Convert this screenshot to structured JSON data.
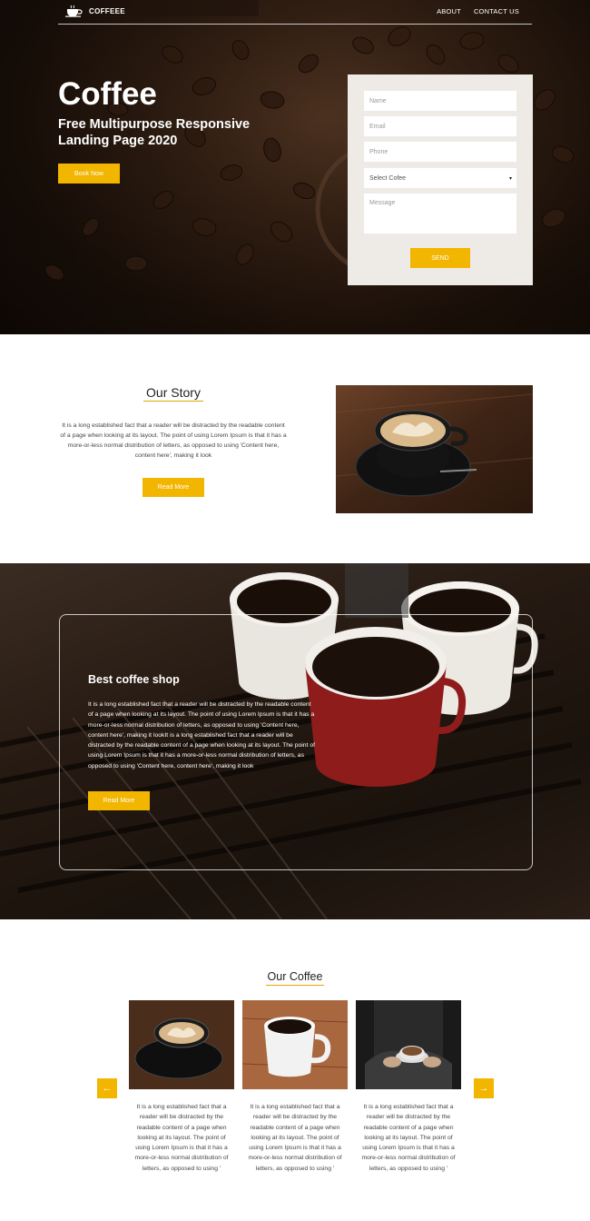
{
  "nav": {
    "logo_text": "COFFEEE",
    "links": [
      "ABOUT",
      "CONTACT US"
    ]
  },
  "hero": {
    "title": "Coffee",
    "subtitle": "Free Multipurpose Responsive Landing Page 2020",
    "book_button": "Book Now"
  },
  "form": {
    "name_placeholder": "Name",
    "email_placeholder": "Email",
    "phone_placeholder": "Phone",
    "select_value": "Select Cofee",
    "message_placeholder": "Message",
    "send_button": "SEND"
  },
  "story": {
    "title": "Our Story",
    "text": "It is a long established fact that a reader will be distracted by the readable content of a page when looking at its layout. The point of using Lorem Ipsum is that it has a more-or-less normal distribution of letters, as opposed to using 'Content here, content here', making it look",
    "button": "Read More"
  },
  "shop": {
    "title": "Best coffee shop",
    "text": "It is a long established fact that a reader will be distracted by the readable content of a page when looking at its layout. The point of using Lorem Ipsum is that it has a more-or-less normal distribution of letters, as opposed to using 'Content here, content here', making it lookIt is a long established fact that a reader will be distracted by the readable content of a page when looking at its layout. The point of using Lorem Ipsum is that it has a more-or-less normal distribution of letters, as opposed to using 'Content here, content here', making it look",
    "button": "Read More"
  },
  "our_coffee": {
    "title": "Our Coffee",
    "cards": [
      {
        "text": "It is a long established fact that a reader will be distracted by the readable content of a page when looking at its layout. The point of using Lorem Ipsum is that it has a more-or-less normal distribution of letters, as opposed to using '"
      },
      {
        "text": "It is a long established fact that a reader will be distracted by the readable content of a page when looking at its layout. The point of using Lorem Ipsum is that it has a more-or-less normal distribution of letters, as opposed to using '"
      },
      {
        "text": "It is a long established fact that a reader will be distracted by the readable content of a page when looking at its layout. The point of using Lorem Ipsum is that it has a more-or-less normal distribution of letters, as opposed to using '"
      }
    ],
    "prev_icon": "arrow-left-icon",
    "next_icon": "arrow-right-icon"
  },
  "colors": {
    "accent": "#f2b500",
    "hero_dark": "#1f120a",
    "form_bg": "#eeebe6"
  }
}
